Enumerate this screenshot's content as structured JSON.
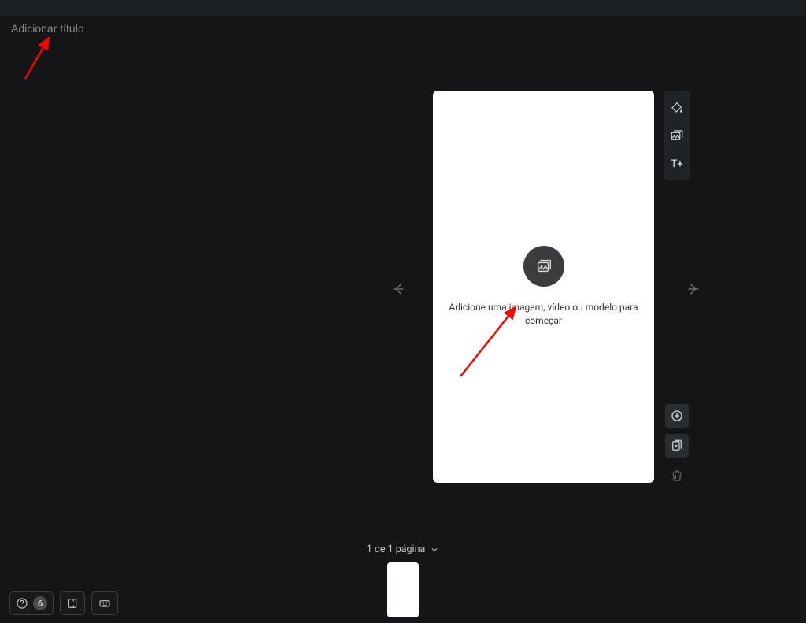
{
  "header": {
    "title_placeholder": "Adicionar título"
  },
  "canvas": {
    "placeholder_line1": "Adicione uma imagem, vídeo ou modelo para",
    "placeholder_line2": "começar"
  },
  "side_tools_top": {
    "background_tool": "background-color",
    "image_tool": "add-image",
    "text_tool": "add-text",
    "text_tool_label": "T+"
  },
  "side_tools_bottom": {
    "add_page": "add-page",
    "duplicate_page": "duplicate-page",
    "delete_page": "delete-page"
  },
  "nav": {
    "prev": "previous-page",
    "next": "next-page"
  },
  "footer": {
    "page_indicator": "1 de 1 página"
  },
  "bottom_left": {
    "help_badge": "6"
  }
}
